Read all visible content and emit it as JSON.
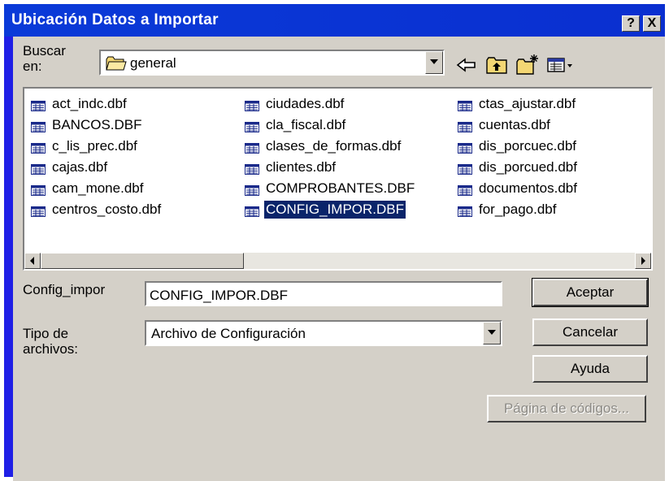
{
  "window": {
    "title": "Ubicación Datos a Importar",
    "help_glyph": "?",
    "close_glyph": "X"
  },
  "lookin": {
    "label": "Buscar en:",
    "value": "general",
    "tools": [
      "back-icon",
      "up-folder-icon",
      "new-folder-icon",
      "view-menu-icon"
    ]
  },
  "files": {
    "columns": [
      [
        "act_indc.dbf",
        "BANCOS.DBF",
        "c_lis_prec.dbf",
        "cajas.dbf",
        "cam_mone.dbf",
        "centros_costo.dbf"
      ],
      [
        "ciudades.dbf",
        "cla_fiscal.dbf",
        "clases_de_formas.dbf",
        "clientes.dbf",
        "COMPROBANTES.DBF",
        "CONFIG_IMPOR.DBF"
      ],
      [
        "ctas_ajustar.dbf",
        "cuentas.dbf",
        "dis_porcuec.dbf",
        "dis_porcued.dbf",
        "documentos.dbf",
        "for_pago.dbf"
      ]
    ],
    "selected": "CONFIG_IMPOR.DBF"
  },
  "filename": {
    "label": "Config_impor",
    "value": "CONFIG_IMPOR.DBF"
  },
  "filetype": {
    "label": "Tipo de archivos:",
    "value": "Archivo de Configuración"
  },
  "buttons": {
    "accept": "Aceptar",
    "cancel": "Cancelar",
    "help": "Ayuda",
    "codepage": "Página de códigos..."
  },
  "colors": {
    "title_bar": "#0a3ad8",
    "dialog_face": "#d4d0c8",
    "selection": "#0a246a",
    "frame": "#1f1fe6"
  }
}
